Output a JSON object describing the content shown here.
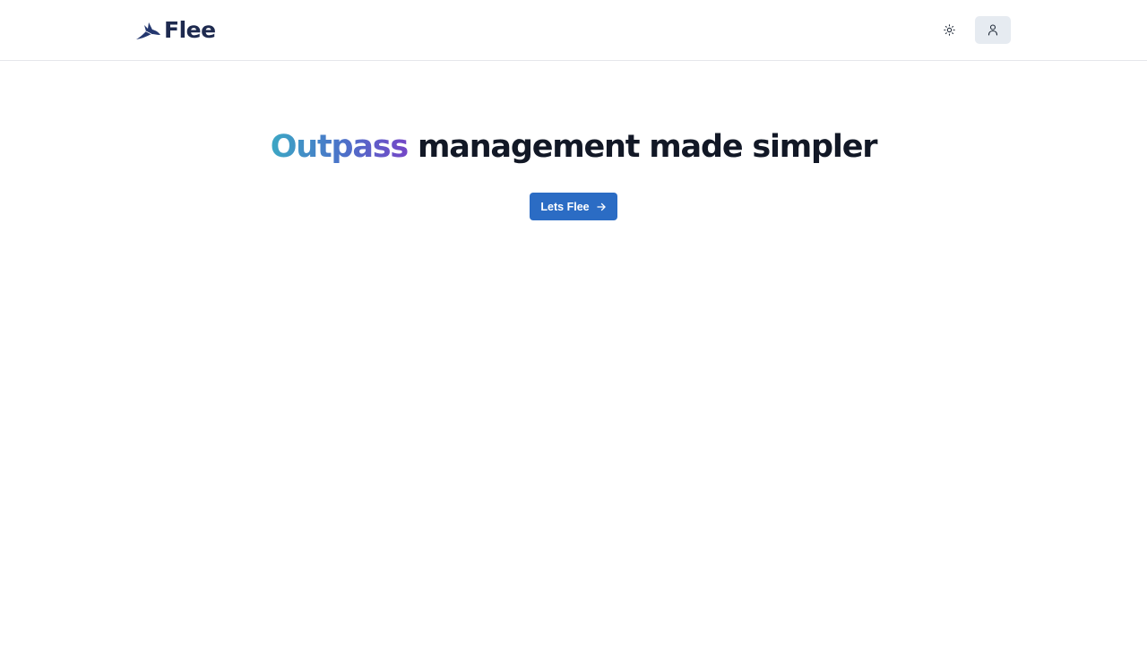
{
  "header": {
    "brand_name": "Flee",
    "logo_icon": "bird-logo-icon",
    "theme_toggle_icon": "sun-icon",
    "profile_icon": "user-icon"
  },
  "hero": {
    "title_highlight": "Outpass",
    "title_rest": "management made simpler",
    "cta_label": "Lets Flee",
    "cta_icon": "arrow-right-icon"
  },
  "colors": {
    "brand": "#1e2a4f",
    "cta_background": "#2b6cc4",
    "gradient_start": "#3ca7c4",
    "gradient_mid": "#4a74c9",
    "gradient_end": "#7446c7",
    "profile_button_background": "#e6ebf1"
  }
}
